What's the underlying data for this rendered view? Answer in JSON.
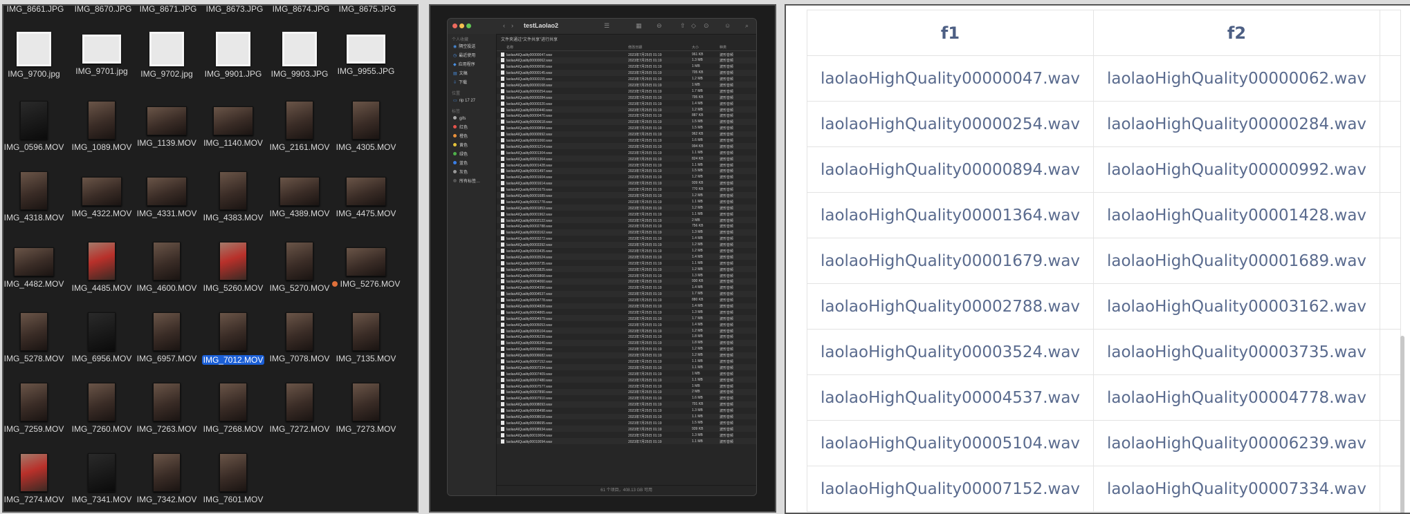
{
  "grid": {
    "top_partial": [
      "IMG_8661.JPG",
      "IMG_8670.JPG",
      "IMG_8671.JPG",
      "IMG_8673.JPG",
      "IMG_8674.JPG",
      "IMG_8675.JPG"
    ],
    "rows": [
      [
        {
          "n": "IMG_9700.jpg",
          "t": "photo"
        },
        {
          "n": "IMG_9701.jpg",
          "t": "photo land2"
        },
        {
          "n": "IMG_9702.jpg",
          "t": "photo"
        },
        {
          "n": "IMG_9901.JPG",
          "t": "photo"
        },
        {
          "n": "IMG_9903.JPG",
          "t": "photo"
        },
        {
          "n": "IMG_9955.JPG",
          "t": "photo land2"
        }
      ],
      [
        {
          "n": "IMG_0596.MOV",
          "t": "port dark"
        },
        {
          "n": "IMG_1089.MOV",
          "t": "port"
        },
        {
          "n": "IMG_1139.MOV",
          "t": "land"
        },
        {
          "n": "IMG_1140.MOV",
          "t": "land"
        },
        {
          "n": "IMG_2161.MOV",
          "t": "port"
        },
        {
          "n": "IMG_4305.MOV",
          "t": "port"
        }
      ],
      [
        {
          "n": "IMG_4318.MOV",
          "t": "port"
        },
        {
          "n": "IMG_4322.MOV",
          "t": "land"
        },
        {
          "n": "IMG_4331.MOV",
          "t": "land"
        },
        {
          "n": "IMG_4383.MOV",
          "t": "port"
        },
        {
          "n": "IMG_4389.MOV",
          "t": "land"
        },
        {
          "n": "IMG_4475.MOV",
          "t": "land"
        }
      ],
      [
        {
          "n": "IMG_4482.MOV",
          "t": "land"
        },
        {
          "n": "IMG_4485.MOV",
          "t": "port red"
        },
        {
          "n": "IMG_4600.MOV",
          "t": "port"
        },
        {
          "n": "IMG_5260.MOV",
          "t": "port red"
        },
        {
          "n": "IMG_5270.MOV",
          "t": "port"
        },
        {
          "n": "IMG_5276.MOV",
          "t": "land",
          "tag": true
        }
      ],
      [
        {
          "n": "IMG_5278.MOV",
          "t": "port"
        },
        {
          "n": "IMG_6956.MOV",
          "t": "port dark"
        },
        {
          "n": "IMG_6957.MOV",
          "t": "port"
        },
        {
          "n": "IMG_7012.MOV",
          "t": "port",
          "sel": true
        },
        {
          "n": "IMG_7078.MOV",
          "t": "port"
        },
        {
          "n": "IMG_7135.MOV",
          "t": "port"
        }
      ],
      [
        {
          "n": "IMG_7259.MOV",
          "t": "port"
        },
        {
          "n": "IMG_7260.MOV",
          "t": "port"
        },
        {
          "n": "IMG_7263.MOV",
          "t": "port"
        },
        {
          "n": "IMG_7268.MOV",
          "t": "port"
        },
        {
          "n": "IMG_7272.MOV",
          "t": "port"
        },
        {
          "n": "IMG_7273.MOV",
          "t": "port"
        }
      ],
      [
        {
          "n": "IMG_7274.MOV",
          "t": "port red"
        },
        {
          "n": "IMG_7341.MOV",
          "t": "port dark"
        },
        {
          "n": "IMG_7342.MOV",
          "t": "port"
        },
        {
          "n": "IMG_7601.MOV",
          "t": "port"
        }
      ]
    ]
  },
  "finder": {
    "title": "testLaolao2",
    "breadcrumb": "文件夹通过“文件共享”进行共享",
    "columns": {
      "name": "名称",
      "date": "修改日期",
      "size": "大小",
      "kind": "种类"
    },
    "sidebar": [
      {
        "head": "个人收藏"
      },
      {
        "label": "隔空投送",
        "ic": "◉"
      },
      {
        "label": "最近使用",
        "ic": "◷"
      },
      {
        "label": "应用程序",
        "ic": "◆"
      },
      {
        "label": "文稿",
        "ic": "▤"
      },
      {
        "label": "下载",
        "ic": "⇩"
      },
      {
        "head": "位置"
      },
      {
        "label": "rip 17 27",
        "ic": "▭"
      },
      {
        "head": "标签"
      },
      {
        "label": "gifs",
        "dot": "#aaaaaa"
      },
      {
        "label": "红色",
        "dot": "#e5534b"
      },
      {
        "label": "橙色",
        "dot": "#e8903a"
      },
      {
        "label": "黄色",
        "dot": "#e5c33a"
      },
      {
        "label": "绿色",
        "dot": "#4fb14a"
      },
      {
        "label": "蓝色",
        "dot": "#3a7ee5"
      },
      {
        "label": "灰色",
        "dot": "#999999"
      },
      {
        "label": "所有标签…",
        "dot": "#555555"
      }
    ],
    "date_value": "2023年7月25日 01:19",
    "kind_value": "波形音频",
    "files": [
      [
        "00000047",
        "961 KB"
      ],
      [
        "00000062",
        "1.3 MB"
      ],
      [
        "00000090",
        "1 MB"
      ],
      [
        "00000145",
        "705 KB"
      ],
      [
        "00000155",
        "1.2 MB"
      ],
      [
        "00000168",
        "1 MB"
      ],
      [
        "00000254",
        "1.7 MB"
      ],
      [
        "00000284",
        "795 KB"
      ],
      [
        "00000320",
        "1.4 MB"
      ],
      [
        "00000440",
        "1.2 MB"
      ],
      [
        "00000470",
        "887 KB"
      ],
      [
        "00000618",
        "1.5 MB"
      ],
      [
        "00000894",
        "1.5 MB"
      ],
      [
        "00000992",
        "962 KB"
      ],
      [
        "00001060",
        "1.6 MB"
      ],
      [
        "00001214",
        "994 KB"
      ],
      [
        "00001304",
        "1.1 MB"
      ],
      [
        "00001364",
        "824 KB"
      ],
      [
        "00001428",
        "1.1 MB"
      ],
      [
        "00001497",
        "1.5 MB"
      ],
      [
        "00001604",
        "1.2 MB"
      ],
      [
        "00001614",
        "939 KB"
      ],
      [
        "00001679",
        "770 KB"
      ],
      [
        "00001689",
        "1.2 MB"
      ],
      [
        "00001778",
        "1.1 MB"
      ],
      [
        "00001853",
        "1.2 MB"
      ],
      [
        "00001962",
        "1.1 MB"
      ],
      [
        "00002122",
        "2 MB"
      ],
      [
        "00002788",
        "756 KB"
      ],
      [
        "00003162",
        "1.3 MB"
      ],
      [
        "00003272",
        "1.4 MB"
      ],
      [
        "00003392",
        "1.2 MB"
      ],
      [
        "00003435",
        "1.2 MB"
      ],
      [
        "00003524",
        "1.4 MB"
      ],
      [
        "00003735",
        "1.1 MB"
      ],
      [
        "00003825",
        "1.2 MB"
      ],
      [
        "00003868",
        "1.3 MB"
      ],
      [
        "00004060",
        "930 KB"
      ],
      [
        "00004390",
        "1.4 MB"
      ],
      [
        "00004537",
        "1.7 MB"
      ],
      [
        "00004778",
        "880 KB"
      ],
      [
        "00004828",
        "1.4 MB"
      ],
      [
        "00004865",
        "1.3 MB"
      ],
      [
        "00004979",
        "1.7 MB"
      ],
      [
        "00005053",
        "1.4 MB"
      ],
      [
        "00005104",
        "1.2 MB"
      ],
      [
        "00006239",
        "1.8 MB"
      ],
      [
        "00006340",
        "1.8 MB"
      ],
      [
        "00006602",
        "1.2 MB"
      ],
      [
        "00006682",
        "1.2 MB"
      ],
      [
        "00007152",
        "1.1 MB"
      ],
      [
        "00007334",
        "1.1 MB"
      ],
      [
        "00007409",
        "1 MB"
      ],
      [
        "00007480",
        "1.1 MB"
      ],
      [
        "00007577",
        "1 MB"
      ],
      [
        "00007890",
        "2 MB"
      ],
      [
        "00007910",
        "1.6 MB"
      ],
      [
        "00008093",
        "701 KB"
      ],
      [
        "00008498",
        "1.3 MB"
      ],
      [
        "00008618",
        "1.1 MB"
      ],
      [
        "00008695",
        "1.5 MB"
      ],
      [
        "00008934",
        "939 KB"
      ],
      [
        "00010004",
        "1.3 MB"
      ],
      [
        "00010094",
        "1.1 MB"
      ]
    ],
    "file_prefix": "laolaoAIQuality",
    "file_suffix": ".wav",
    "status": "61 个项目，408.13 GB 可用"
  },
  "table": {
    "headers": [
      "f1",
      "f2"
    ],
    "rows": [
      [
        "laolaoHighQuality00000047.wav",
        "laolaoHighQuality00000062.wav"
      ],
      [
        "laolaoHighQuality00000254.wav",
        "laolaoHighQuality00000284.wav"
      ],
      [
        "laolaoHighQuality00000894.wav",
        "laolaoHighQuality00000992.wav"
      ],
      [
        "laolaoHighQuality00001364.wav",
        "laolaoHighQuality00001428.wav"
      ],
      [
        "laolaoHighQuality00001679.wav",
        "laolaoHighQuality00001689.wav"
      ],
      [
        "laolaoHighQuality00002788.wav",
        "laolaoHighQuality00003162.wav"
      ],
      [
        "laolaoHighQuality00003524.wav",
        "laolaoHighQuality00003735.wav"
      ],
      [
        "laolaoHighQuality00004537.wav",
        "laolaoHighQuality00004778.wav"
      ],
      [
        "laolaoHighQuality00005104.wav",
        "laolaoHighQuality00006239.wav"
      ],
      [
        "laolaoHighQuality00007152.wav",
        "laolaoHighQuality00007334.wav"
      ]
    ]
  }
}
